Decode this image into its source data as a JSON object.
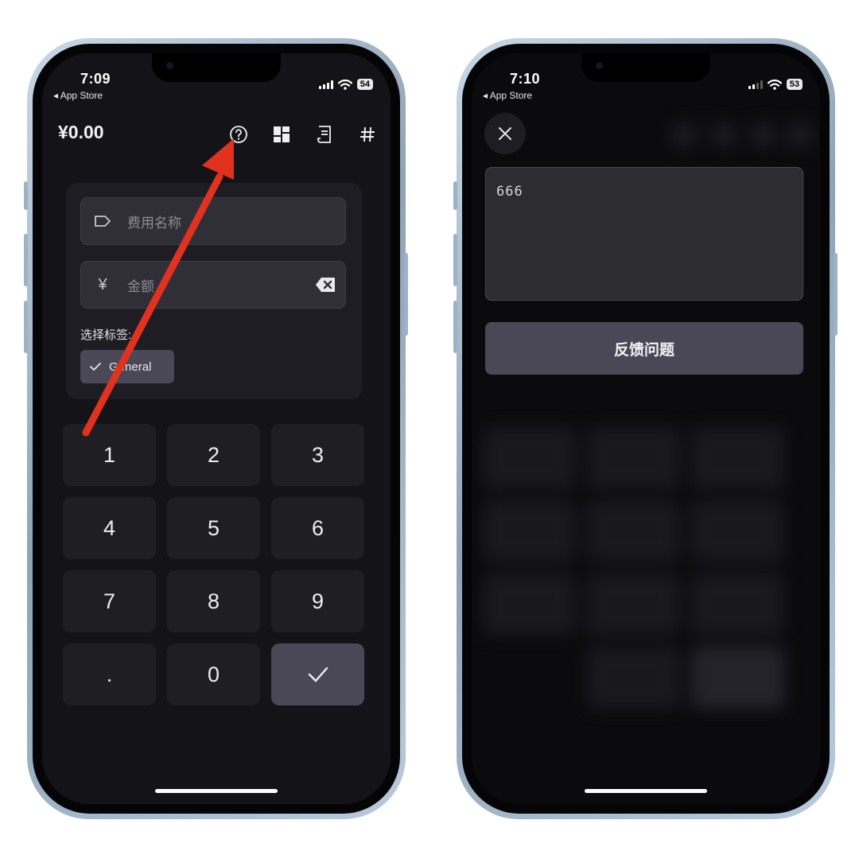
{
  "left_phone": {
    "status": {
      "time": "7:09",
      "back_label": "◂ App Store",
      "battery": "54"
    },
    "header": {
      "amount": "¥0.00",
      "icons": [
        "help-icon",
        "dashboard-icon",
        "receipt-icon",
        "hash-icon"
      ]
    },
    "form": {
      "name_placeholder": "费用名称",
      "amount_placeholder": "金额",
      "currency_symbol": "¥",
      "tags_label": "选择标签:",
      "selected_tag": "General"
    },
    "keypad": [
      "1",
      "2",
      "3",
      "4",
      "5",
      "6",
      "7",
      "8",
      "9",
      ".",
      "0"
    ],
    "annotation": {
      "arrow_color": "#e0321e"
    }
  },
  "right_phone": {
    "status": {
      "time": "7:10",
      "back_label": "◂ App Store",
      "battery": "53"
    },
    "feedback_text": "666",
    "feedback_button": "反馈问题"
  }
}
